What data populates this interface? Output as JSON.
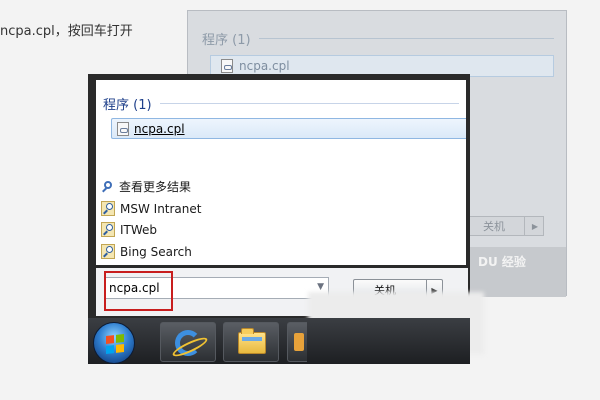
{
  "caption": {
    "text": "ncpa.cpl，按回车打开"
  },
  "background_window": {
    "section_title": "程序 (1)",
    "item_label": "ncpa.cpl",
    "shutdown_label": "关机",
    "watermark_text": "DU 经验"
  },
  "start_menu": {
    "section_title": "程序 (1)",
    "results": [
      {
        "label": "ncpa.cpl",
        "icon": "control-panel-file-icon"
      }
    ],
    "see_more_label": "查看更多结果",
    "links": [
      {
        "label": "MSW Intranet",
        "icon": "search-link-icon"
      },
      {
        "label": "ITWeb",
        "icon": "search-link-icon"
      },
      {
        "label": "Bing Search",
        "icon": "search-link-icon"
      }
    ],
    "search": {
      "value": "ncpa.cpl",
      "dropdown_icon": "chevron-down-icon"
    },
    "shutdown": {
      "label": "关机",
      "arrow_icon": "chevron-right-icon"
    }
  },
  "taskbar": {
    "start_button_icon": "windows-logo-icon",
    "pinned": [
      {
        "name": "Internet Explorer",
        "icon": "ie-icon"
      },
      {
        "name": "Windows Explorer",
        "icon": "folder-icon"
      }
    ]
  },
  "colors": {
    "highlight_border": "#c81e1e",
    "selection_fill": "#dbe9f8",
    "section_title": "#1e3f8a"
  }
}
